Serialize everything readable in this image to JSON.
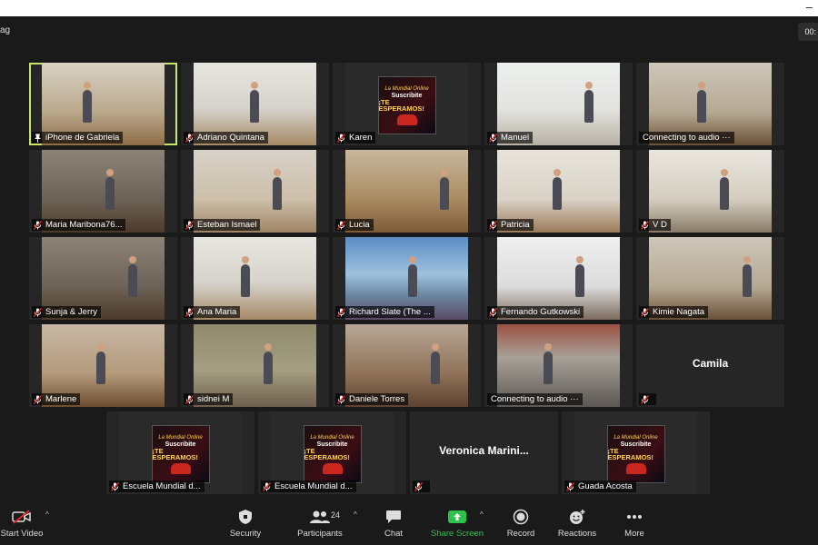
{
  "window": {
    "left_fragment": "ag",
    "timer_fragment": "00:"
  },
  "tiles": [
    {
      "name": "iPhone de Gabriela",
      "active": true,
      "muted": false,
      "scene": "hall"
    },
    {
      "name": "Adriano Quintana",
      "muted": true,
      "scene": "living"
    },
    {
      "name": "Karen",
      "muted": true,
      "scene": "poster"
    },
    {
      "name": "Manuel",
      "muted": true,
      "scene": "bright"
    },
    {
      "name": "Connecting to audio ···",
      "muted": false,
      "scene": "door"
    },
    {
      "name": "Maria Maribona76...",
      "muted": true,
      "scene": "room1"
    },
    {
      "name": "Esteban Ismael",
      "muted": true,
      "scene": "room2"
    },
    {
      "name": "Lucia",
      "muted": true,
      "scene": "wood"
    },
    {
      "name": "Patricia",
      "muted": true,
      "scene": "face"
    },
    {
      "name": "V D",
      "muted": true,
      "scene": "studio"
    },
    {
      "name": "Sunja & Jerry",
      "muted": true,
      "scene": "room1"
    },
    {
      "name": "Ana Maria",
      "muted": true,
      "scene": "living"
    },
    {
      "name": "Richard Slate (The ...",
      "muted": true,
      "scene": "beach"
    },
    {
      "name": "Fernando Gutkowski",
      "muted": true,
      "scene": "chairs"
    },
    {
      "name": "Kimie Nagata",
      "muted": true,
      "scene": "door"
    },
    {
      "name": "Marlene",
      "muted": true,
      "scene": "pink"
    },
    {
      "name": "sidnei M",
      "muted": true,
      "scene": "kitchen"
    },
    {
      "name": "Daniele Torres",
      "muted": true,
      "scene": "den"
    },
    {
      "name": "Connecting to audio ···",
      "muted": false,
      "scene": "old"
    },
    {
      "name": "",
      "center": "Camila",
      "muted": true,
      "scene": "none"
    },
    {
      "name": "Escuela Mundial d...",
      "muted": true,
      "scene": "poster"
    },
    {
      "name": "Escuela Mundial d...",
      "muted": true,
      "scene": "poster"
    },
    {
      "name": "",
      "center": "Veronica  Marini...",
      "muted": true,
      "scene": "none"
    },
    {
      "name": "Guada Acosta",
      "muted": true,
      "scene": "poster"
    }
  ],
  "poster": {
    "line1": "La Mundial Online",
    "line2": "Suscribite",
    "line3": "¡TE ESPERAMOS!"
  },
  "toolbar": {
    "start_video": "Start Video",
    "security": "Security",
    "participants": "Participants",
    "participants_count": "24",
    "chat": "Chat",
    "share_screen": "Share Screen",
    "record": "Record",
    "reactions": "Reactions",
    "more": "More"
  },
  "colors": {
    "active_border": "#c8e66b",
    "share_green": "#2ec24d",
    "muted_red": "#e02828"
  }
}
